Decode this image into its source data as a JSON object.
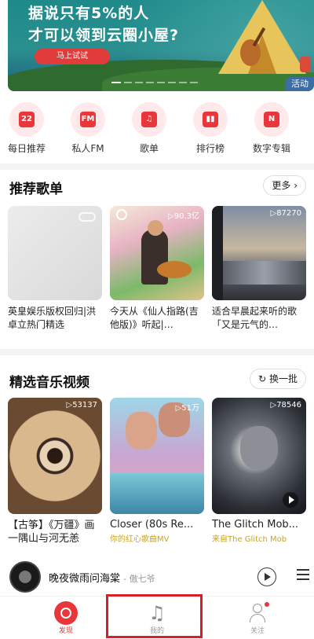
{
  "banner": {
    "line1": "据说只有5%的人",
    "line2": "才可以领到云圈小屋?",
    "button": "马上试试",
    "tag": "活动"
  },
  "quick_entries": [
    {
      "label": "每日推荐",
      "glyph": "22",
      "icon": "calendar-icon"
    },
    {
      "label": "私人FM",
      "glyph": "FM",
      "icon": "radio-icon"
    },
    {
      "label": "歌单",
      "glyph": "♫",
      "icon": "playlist-icon"
    },
    {
      "label": "排行榜",
      "glyph": "▮▮",
      "icon": "chart-icon"
    },
    {
      "label": "数字专辑",
      "glyph": "N",
      "icon": "album-icon"
    }
  ],
  "playlists": {
    "title": "推荐歌单",
    "more": "更多",
    "items": [
      {
        "title": "英皇娱乐版权回归|洪卓立热门精选",
        "count": ""
      },
      {
        "title": "今天从《仙人指路(吉他版)》听起|…",
        "count": "90.3亿"
      },
      {
        "title": "适合早晨起来听的歌「又是元气的…",
        "count": "87270"
      }
    ]
  },
  "videos": {
    "title": "精选音乐视频",
    "refresh": "换一批",
    "items": [
      {
        "title": "【古筝】《万疆》画一隅山与河无恙",
        "sub": "",
        "count": "53137"
      },
      {
        "title": "Closer (80s Re...",
        "sub": "你的红心歌曲MV",
        "count": "51万"
      },
      {
        "title": "The Glitch Mob...",
        "sub": "来自The Glitch Mob",
        "count": "78546"
      }
    ]
  },
  "player": {
    "song": "晚夜微雨问海棠",
    "artist": "- 傲七爷"
  },
  "nav": [
    {
      "label": "发现"
    },
    {
      "label": "我的"
    },
    {
      "label": "关注"
    }
  ],
  "colors": {
    "accent": "#e8363b",
    "highlight_box": "#d61f26"
  }
}
